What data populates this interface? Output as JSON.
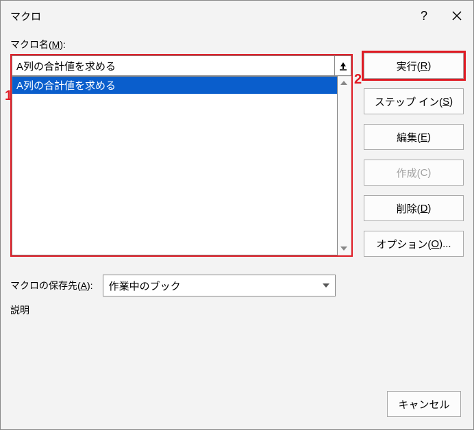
{
  "titlebar": {
    "title": "マクロ"
  },
  "labels": {
    "macro_name_pre": "マクロ名(",
    "macro_name_u": "M",
    "macro_name_post": "):",
    "save_pre": "マクロの保存先(",
    "save_u": "A",
    "save_post": "):",
    "description": "説明"
  },
  "input": {
    "value": "A列の合計値を求める"
  },
  "list": {
    "items": [
      "A列の合計値を求める"
    ]
  },
  "save_select": {
    "value": "作業中のブック"
  },
  "buttons": {
    "run_pre": "実行(",
    "run_u": "R",
    "run_post": ")",
    "step_pre": "ステップ イン(",
    "step_u": "S",
    "step_post": ")",
    "edit_pre": "編集(",
    "edit_u": "E",
    "edit_post": ")",
    "create_pre": "作成(",
    "create_u": "C",
    "create_post": ")",
    "delete_pre": "削除(",
    "delete_u": "D",
    "delete_post": ")",
    "options_pre": "オプション(",
    "options_u": "O",
    "options_post": ")...",
    "cancel": "キャンセル"
  },
  "annotations": {
    "one": "1",
    "two": "2"
  }
}
